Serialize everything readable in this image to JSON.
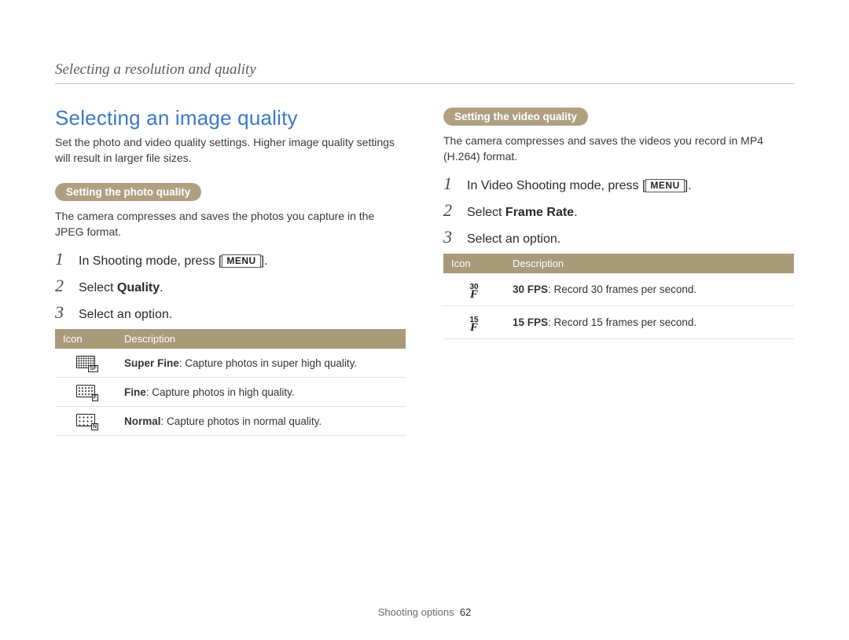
{
  "breadcrumb": "Selecting a resolution and quality",
  "section_title": "Selecting an image quality",
  "intro": "Set the photo and video quality settings. Higher image quality settings will result in larger file sizes.",
  "menu_label": "MENU",
  "photo": {
    "pill": "Setting the photo quality",
    "desc": "The camera compresses and saves the photos you capture in the JPEG format.",
    "steps": {
      "s1_pre": "In Shooting mode, press [",
      "s1_post": "].",
      "s2_pre": "Select ",
      "s2_bold": "Quality",
      "s2_post": ".",
      "s3": "Select an option."
    },
    "table": {
      "h1": "Icon",
      "h2": "Description",
      "rows": [
        {
          "bold": "Super Fine",
          "rest": ": Capture photos in super high quality."
        },
        {
          "bold": "Fine",
          "rest": ": Capture photos in high quality."
        },
        {
          "bold": "Normal",
          "rest": ": Capture photos in normal quality."
        }
      ]
    }
  },
  "video": {
    "pill": "Setting the video quality",
    "desc": "The camera compresses and saves the videos you record in MP4 (H.264) format.",
    "steps": {
      "s1_pre": "In Video Shooting mode, press [",
      "s1_post": "].",
      "s2_pre": "Select ",
      "s2_bold": "Frame Rate",
      "s2_post": ".",
      "s3": "Select an option."
    },
    "table": {
      "h1": "Icon",
      "h2": "Description",
      "rows": [
        {
          "bold": "30 FPS",
          "rest": ": Record 30 frames per second."
        },
        {
          "bold": "15 FPS",
          "rest": ": Record 15 frames per second."
        }
      ]
    }
  },
  "footer": {
    "label": "Shooting options",
    "page": "62"
  }
}
